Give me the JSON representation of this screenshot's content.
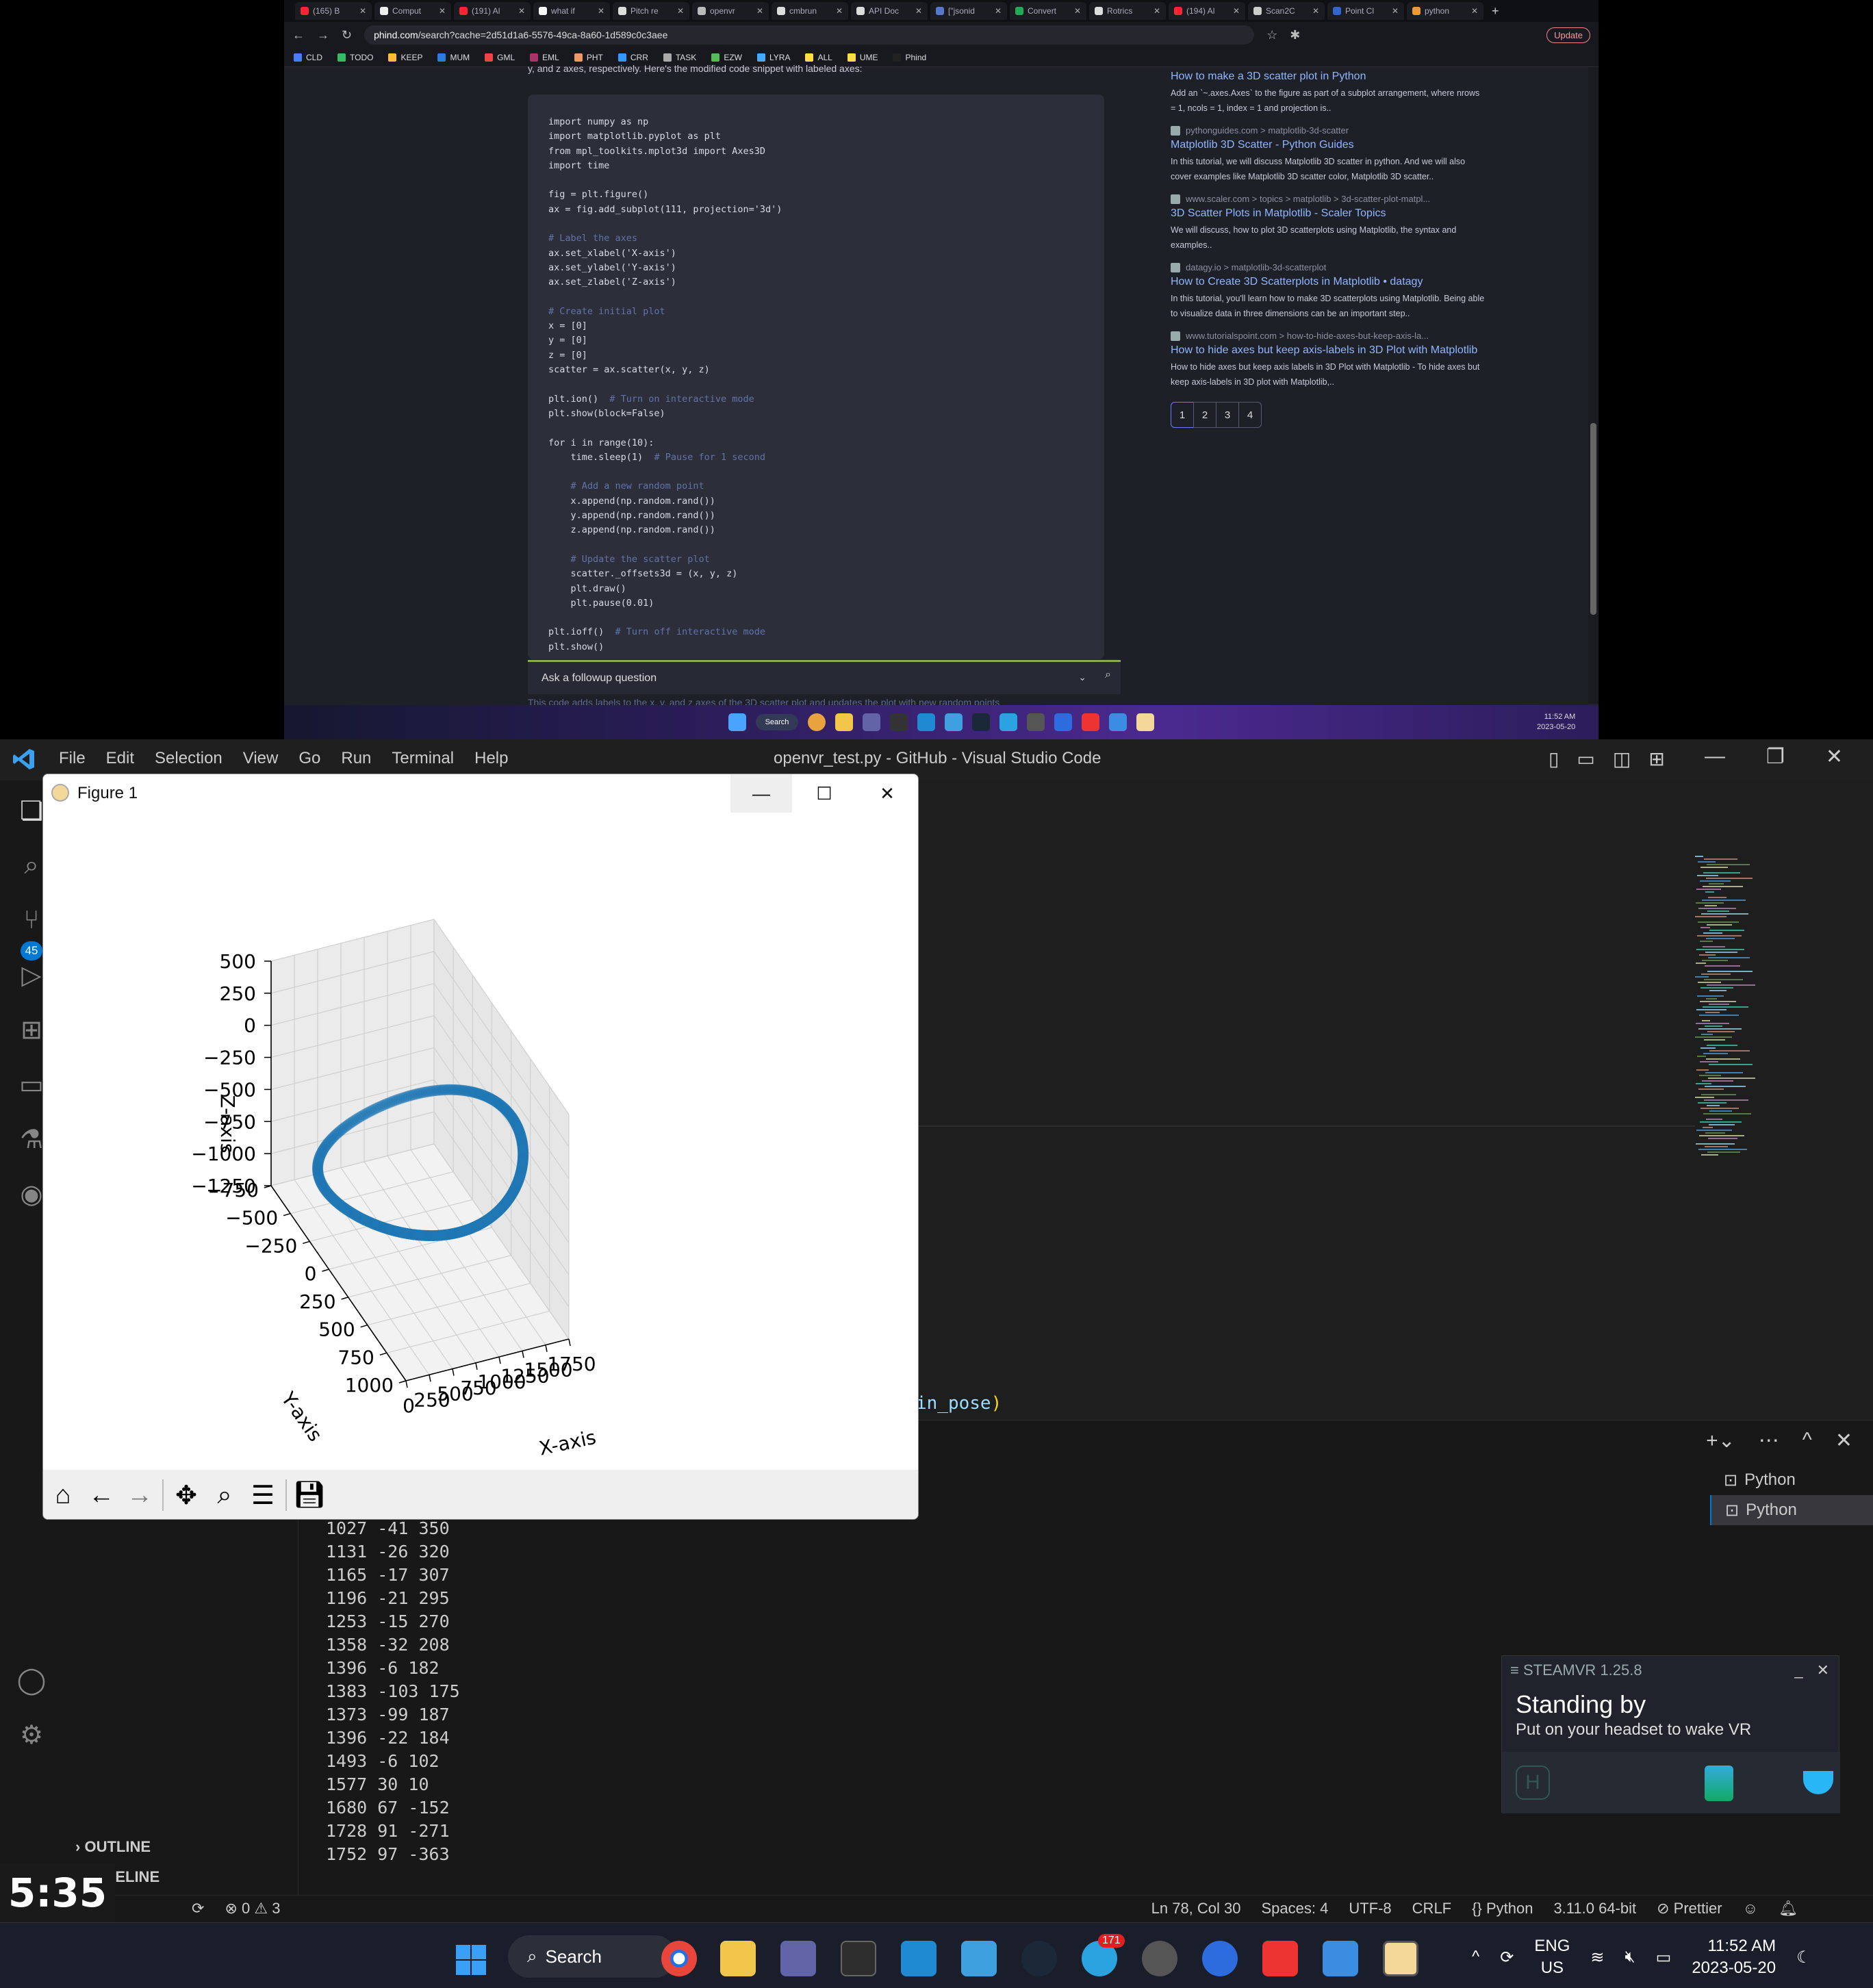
{
  "browser": {
    "tabs": [
      "(165) B",
      "Comput",
      "(191) Al",
      "what if",
      "Pitch re",
      "openvr",
      "cmbrun",
      "API Doc",
      "[\"jsonid",
      "Convert",
      "Rotrics",
      "(194) Al",
      "Scan2C",
      "Point Cl",
      "python"
    ],
    "url_host": "phind.com",
    "url_rest": "/search?cache=2d51d1a6-5576-49ca-8a60-1d589c0c3aee",
    "update_label": "Update",
    "bookmarks": [
      "CLD",
      "TODO",
      "KEEP",
      "MUM",
      "GML",
      "EML",
      "PHT",
      "CRR",
      "TASK",
      "EZW",
      "LYRA",
      "ALL",
      "UME",
      "Phind"
    ],
    "intro_text": "y, and z axes, respectively. Here's the modified code snippet with labeled axes:",
    "code_lines": [
      "import numpy as np",
      "import matplotlib.pyplot as plt",
      "from mpl_toolkits.mplot3d import Axes3D",
      "import time",
      "",
      "fig = plt.figure()",
      "ax = fig.add_subplot(111, projection='3d')",
      "",
      "# Label the axes",
      "ax.set_xlabel('X-axis')",
      "ax.set_ylabel('Y-axis')",
      "ax.set_zlabel('Z-axis')",
      "",
      "# Create initial plot",
      "x = [0]",
      "y = [0]",
      "z = [0]",
      "scatter = ax.scatter(x, y, z)",
      "",
      "plt.ion()  # Turn on interactive mode",
      "plt.show(block=False)",
      "",
      "for i in range(10):",
      "    time.sleep(1)  # Pause for 1 second",
      "",
      "    # Add a new random point",
      "    x.append(np.random.rand())",
      "    y.append(np.random.rand())",
      "    z.append(np.random.rand())",
      "",
      "    # Update the scatter plot",
      "    scatter._offsets3d = (x, y, z)",
      "    plt.draw()",
      "    plt.pause(0.01)",
      "",
      "plt.ioff()  # Turn off interactive mode",
      "plt.show()"
    ],
    "followup_placeholder": "Ask a followup question",
    "below_text": "This code adds labels to the x, y, and z axes of the 3D scatter plot and updates the plot with new random points",
    "results": [
      {
        "source": "",
        "title": "How to make a 3D scatter plot in Python",
        "snippet": "Add an `~.axes.Axes` to the figure as part of a subplot arrangement, where nrows = 1, ncols = 1, index = 1 and projection is.."
      },
      {
        "source": "pythonguides.com > matplotlib-3d-scatter",
        "title": "Matplotlib 3D Scatter - Python Guides",
        "snippet": "In this tutorial, we will discuss Matplotlib 3D scatter in python. And we will also cover examples like Matplotlib 3D scatter color, Matplotlib 3D scatter.."
      },
      {
        "source": "www.scaler.com > topics > matplotlib > 3d-scatter-plot-matpl...",
        "title": "3D Scatter Plots in Matplotlib - Scaler Topics",
        "snippet": "We will discuss, how to plot 3D scatterplots using Matplotlib, the syntax and examples.."
      },
      {
        "source": "datagy.io > matplotlib-3d-scatterplot",
        "title": "How to Create 3D Scatterplots in Matplotlib • datagy",
        "snippet": "In this tutorial, you'll learn how to make 3D scatterplots using Matplotlib. Being able to visualize data in three dimensions can be an important step.."
      },
      {
        "source": "www.tutorialspoint.com > how-to-hide-axes-but-keep-axis-la...",
        "title": "How to hide axes but keep axis-labels in 3D Plot with Matplotlib",
        "snippet": "How to hide axes but keep axis labels in 3D Plot with Matplotlib - To hide axes but keep axis-labels in 3D plot with Matplotlib,.."
      }
    ],
    "pages": [
      "1",
      "2",
      "3",
      "4"
    ],
    "taskbar_search": "Search",
    "time": "11:52 AM",
    "date": "2023-05-20"
  },
  "vscode": {
    "menu": [
      "File",
      "Edit",
      "Selection",
      "View",
      "Go",
      "Run",
      "Terminal",
      "Help"
    ],
    "title": "openvr_test.py - GitHub - Visual Studio Code",
    "scm_badge": "45",
    "editor_fragment": "in_pose",
    "editor_paren": ")",
    "terminal_lines": [
      "1027 -41 350",
      "1131 -26 320",
      "1165 -17 307",
      "1196 -21 295",
      "1253 -15 270",
      "1358 -32 208",
      "1396 -6 182",
      "1383 -103 175",
      "1373 -99 187",
      "1396 -22 184",
      "1493 -6 102",
      "1577 30 10",
      "1680 67 -152",
      "1728 91 -271",
      "1752 97 -363"
    ],
    "terminals": [
      "Python",
      "Python"
    ],
    "outline_label": "OUTLINE",
    "timeline_label": "MELINE",
    "status": {
      "errors": "0",
      "warnings": "3",
      "position": "Ln 78, Col 30",
      "spaces": "Spaces: 4",
      "encoding": "UTF-8",
      "eol": "CRLF",
      "language": "Python",
      "interpreter": "3.11.0 64-bit",
      "formatter": "Prettier"
    }
  },
  "figure": {
    "window_title": "Figure 1",
    "toolbar_icons": [
      "home-icon",
      "back-icon",
      "forward-icon",
      "pan-icon",
      "zoom-icon",
      "configure-icon",
      "save-icon"
    ]
  },
  "chart_data": {
    "type": "scatter",
    "title": "",
    "xlabel": "X-axis",
    "ylabel": "Y-axis",
    "zlabel": "Z-axis",
    "x_ticks": [
      "0",
      "250",
      "500",
      "750",
      "1000",
      "1250",
      "1500",
      "1750"
    ],
    "y_ticks": [
      "1000",
      "750",
      "500",
      "250",
      "0",
      "−250",
      "−500",
      "−750"
    ],
    "z_ticks": [
      "500",
      "250",
      "0",
      "−250",
      "−500",
      "−750",
      "−1000",
      "−1250"
    ],
    "xlim": [
      0,
      1750
    ],
    "ylim": [
      -750,
      1000
    ],
    "zlim": [
      -1250,
      500
    ],
    "grid": true,
    "color": "#1f77b4",
    "series": [
      {
        "shape": "tilted-ellipse",
        "center": [
          900,
          100,
          -500
        ],
        "radius_x": 850,
        "radius_y": 850,
        "points": 260
      }
    ]
  },
  "steamvr": {
    "header": "STEAMVR 1.25.8",
    "title": "Standing by",
    "subtitle": "Put on your headset to wake VR"
  },
  "clock_overlay": "5:35",
  "taskbar": {
    "search": "Search",
    "telegram_badge": "171",
    "lang": "ENG",
    "region": "US",
    "time": "11:52 AM",
    "date": "2023-05-20"
  }
}
